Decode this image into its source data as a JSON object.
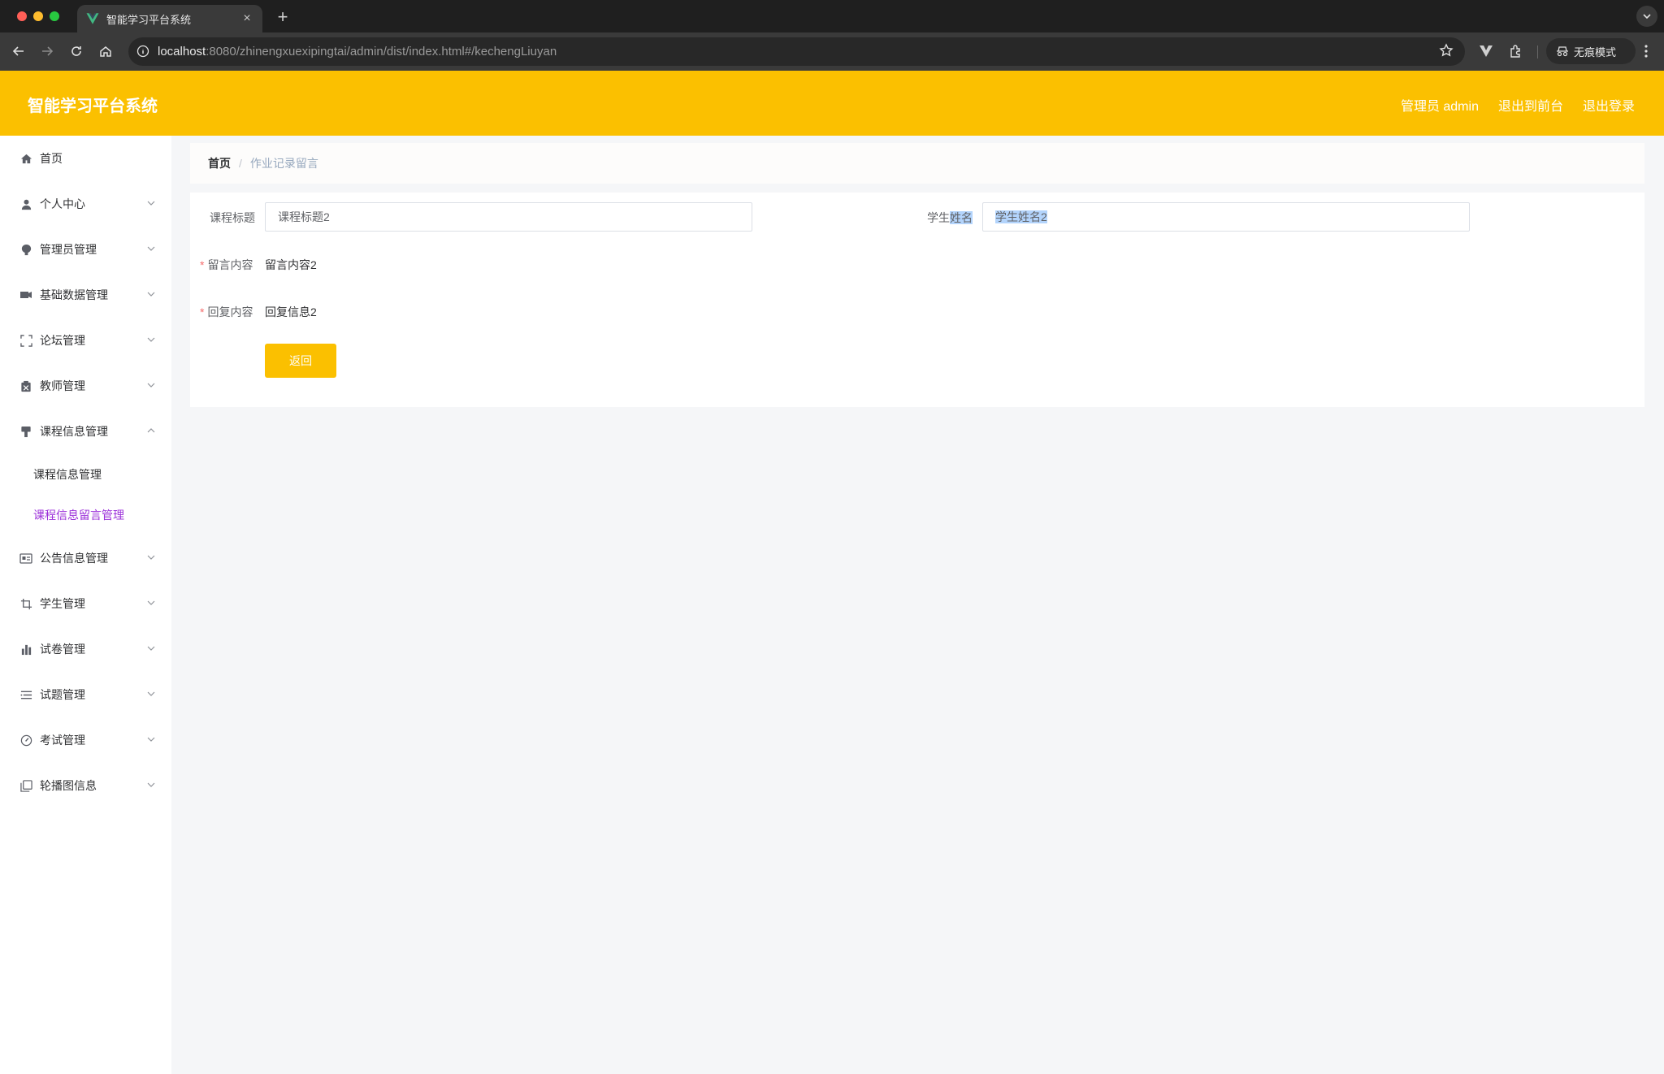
{
  "browser": {
    "tab_title": "智能学习平台系统",
    "url_host": "localhost",
    "url_rest": ":8080/zhinengxuexipingtai/admin/dist/index.html#/kechengLiuyan",
    "incognito_label": "无痕模式"
  },
  "header": {
    "title": "智能学习平台系统",
    "links": [
      "管理员 admin",
      "退出到前台",
      "退出登录"
    ]
  },
  "sidebar": {
    "items": [
      {
        "label": "首页",
        "icon": "home-icon"
      },
      {
        "label": "个人中心",
        "icon": "user-icon"
      },
      {
        "label": "管理员管理",
        "icon": "admin-icon"
      },
      {
        "label": "基础数据管理",
        "icon": "data-icon"
      },
      {
        "label": "论坛管理",
        "icon": "forum-icon"
      },
      {
        "label": "教师管理",
        "icon": "teacher-icon"
      },
      {
        "label": "课程信息管理",
        "icon": "course-icon",
        "expanded": true,
        "children": [
          "课程信息管理",
          "课程信息留言管理"
        ]
      },
      {
        "label": "公告信息管理",
        "icon": "notice-icon"
      },
      {
        "label": "学生管理",
        "icon": "student-icon"
      },
      {
        "label": "试卷管理",
        "icon": "paper-icon"
      },
      {
        "label": "试题管理",
        "icon": "question-icon"
      },
      {
        "label": "考试管理",
        "icon": "exam-icon"
      },
      {
        "label": "轮播图信息",
        "icon": "carousel-icon"
      }
    ],
    "active_child": "课程信息留言管理"
  },
  "breadcrumb": {
    "home": "首页",
    "separator": "/",
    "current": "作业记录留言"
  },
  "form": {
    "course_title_label": "课程标题",
    "course_title_value": "课程标题2",
    "student_name_label_a": "学生",
    "student_name_label_b": "姓名",
    "student_name_value_a": "学生姓名2",
    "message_label": "留言内容",
    "message_value": "留言内容2",
    "reply_label": "回复内容",
    "reply_value": "回复信息2",
    "required_mark": "*",
    "back_button": "返回"
  },
  "colors": {
    "accent": "#fbc000",
    "active_menu": "#9b30d9",
    "selection": "#b3d4fc"
  }
}
